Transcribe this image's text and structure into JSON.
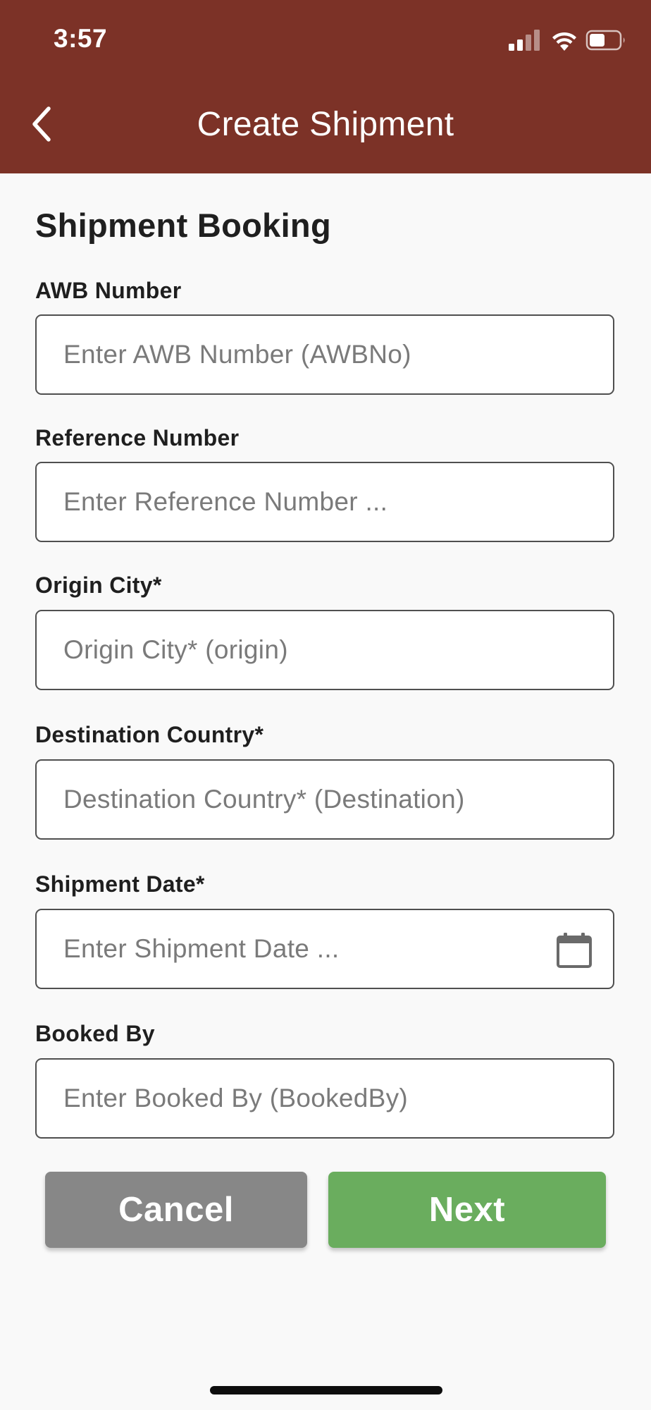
{
  "status_bar": {
    "time": "3:57"
  },
  "header": {
    "title": "Create Shipment",
    "background_color": "#7c3227",
    "back_icon": "chevron-left-icon"
  },
  "form": {
    "section_title": "Shipment Booking",
    "fields": [
      {
        "label": "AWB Number",
        "placeholder": "Enter AWB Number (AWBNo)",
        "value": ""
      },
      {
        "label": "Reference Number",
        "placeholder": "Enter Reference Number ...",
        "value": ""
      },
      {
        "label": "Origin City*",
        "placeholder": "Origin City* (origin)",
        "value": ""
      },
      {
        "label": "Destination Country*",
        "placeholder": "Destination Country* (Destination)",
        "value": ""
      },
      {
        "label": "Shipment Date*",
        "placeholder": "Enter Shipment Date ...",
        "value": "",
        "icon": "calendar-icon"
      },
      {
        "label": "Booked By",
        "placeholder": "Enter Booked By (BookedBy)",
        "value": ""
      }
    ]
  },
  "buttons": {
    "cancel_label": "Cancel",
    "next_label": "Next",
    "cancel_color": "#878787",
    "next_color": "#6aad5e"
  }
}
